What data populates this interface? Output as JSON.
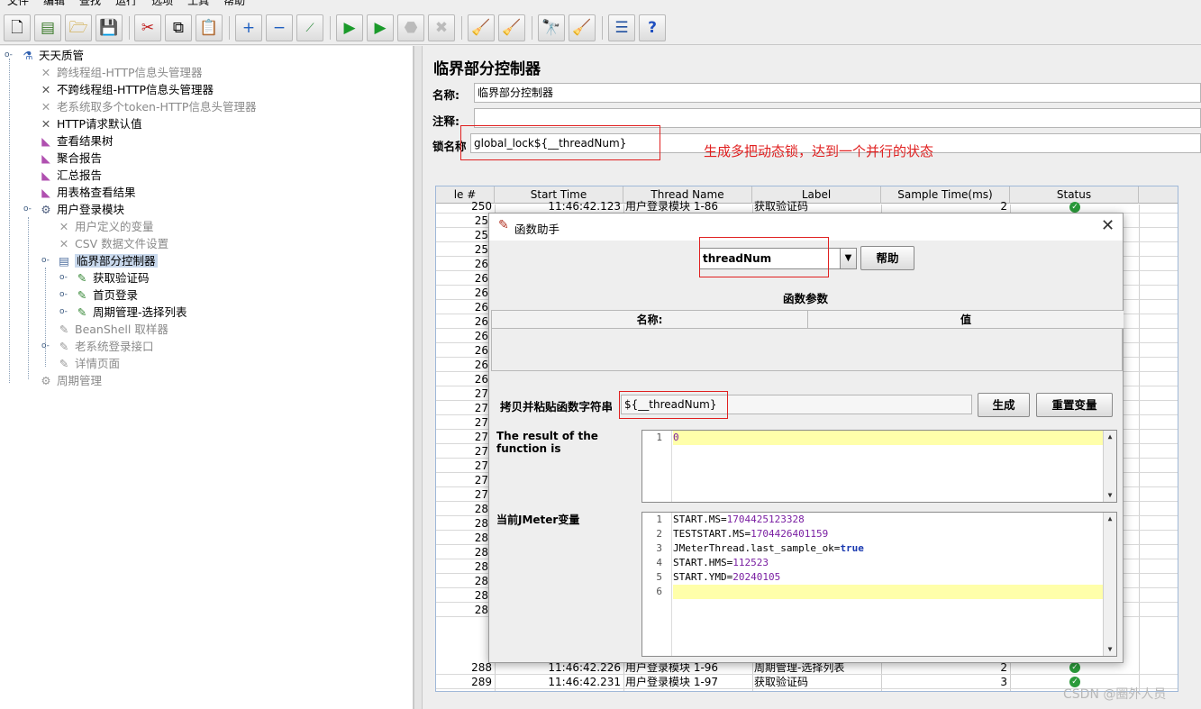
{
  "menubar": [
    "文件",
    "编辑",
    "查找",
    "运行",
    "选项",
    "工具",
    "帮助"
  ],
  "tree": {
    "nodes": [
      {
        "label": "天天质管",
        "icon": "test-plan-icon",
        "enabled": true,
        "selected": false
      },
      {
        "label": "跨线程组-HTTP信息头管理器",
        "icon": "wrench-icon",
        "enabled": false,
        "selected": false
      },
      {
        "label": "不跨线程组-HTTP信息头管理器",
        "icon": "wrench-icon",
        "enabled": true,
        "selected": false
      },
      {
        "label": "老系统取多个token-HTTP信息头管理器",
        "icon": "wrench-icon",
        "enabled": false,
        "selected": false
      },
      {
        "label": "HTTP请求默认值",
        "icon": "wrench-icon",
        "enabled": true,
        "selected": false
      },
      {
        "label": "查看结果树",
        "icon": "listener-icon",
        "enabled": true,
        "selected": false
      },
      {
        "label": "聚合报告",
        "icon": "listener-icon",
        "enabled": true,
        "selected": false
      },
      {
        "label": "汇总报告",
        "icon": "listener-icon",
        "enabled": true,
        "selected": false
      },
      {
        "label": "用表格查看结果",
        "icon": "listener-icon",
        "enabled": true,
        "selected": false
      },
      {
        "label": "用户登录模块",
        "icon": "gear-icon",
        "enabled": true,
        "selected": false
      },
      {
        "label": "用户定义的变量",
        "icon": "wrench-icon",
        "enabled": false,
        "selected": false
      },
      {
        "label": "CSV 数据文件设置",
        "icon": "wrench-icon",
        "enabled": false,
        "selected": false
      },
      {
        "label": "临界部分控制器",
        "icon": "controller-icon",
        "enabled": true,
        "selected": true
      },
      {
        "label": "获取验证码",
        "icon": "sampler-icon",
        "enabled": true,
        "selected": false
      },
      {
        "label": "首页登录",
        "icon": "sampler-icon",
        "enabled": true,
        "selected": false
      },
      {
        "label": "周期管理-选择列表",
        "icon": "sampler-icon",
        "enabled": true,
        "selected": false
      },
      {
        "label": "BeanShell 取样器",
        "icon": "sampler-icon",
        "enabled": false,
        "selected": false
      },
      {
        "label": "老系统登录接口",
        "icon": "sampler-icon",
        "enabled": false,
        "selected": false
      },
      {
        "label": "详情页面",
        "icon": "sampler-icon",
        "enabled": false,
        "selected": false
      },
      {
        "label": "周期管理",
        "icon": "gear-icon",
        "enabled": false,
        "selected": false
      }
    ]
  },
  "panel": {
    "title": "临界部分控制器",
    "name_label": "名称:",
    "name_value": "临界部分控制器",
    "comment_label": "注释:",
    "comment_value": "",
    "lock_label": "锁名称",
    "lock_value": "global_lock${__threadNum}",
    "annotation": "生成多把动态锁，达到一个并行的状态"
  },
  "results_table": {
    "columns": [
      "le #",
      "Start Time",
      "Thread Name",
      "Label",
      "Sample Time(ms)",
      "Status"
    ],
    "top_row": {
      "num": "250",
      "start": "11:46:42.123",
      "thread": "用户登录模块 1-86",
      "label": "获取验证码",
      "time": "2"
    },
    "row_numbers": [
      "25",
      "25",
      "25",
      "26",
      "26",
      "26",
      "26",
      "26",
      "26",
      "26",
      "26",
      "26",
      "27",
      "27",
      "27",
      "27",
      "27",
      "27",
      "27",
      "27",
      "28",
      "28",
      "28",
      "28",
      "28",
      "28",
      "28",
      "28"
    ],
    "bottom_rows": [
      {
        "num": "288",
        "start": "11:46:42.226",
        "thread": "用户登录模块 1-96",
        "label": "周期管理-选择列表",
        "time": "2"
      },
      {
        "num": "289",
        "start": "11:46:42.231",
        "thread": "用户登录模块 1-97",
        "label": "获取验证码",
        "time": "3"
      }
    ]
  },
  "dialog": {
    "title": "函数助手",
    "function_selected": "threadNum",
    "help_button": "帮助",
    "params_title": "函数参数",
    "params_columns": [
      "名称:",
      "值"
    ],
    "copy_label": "拷贝并粘贴函数字符串",
    "copy_value": "${__threadNum}",
    "generate_button": "生成",
    "reset_button": "重置变量",
    "result_label": "The result of the function is",
    "result_lines": [
      {
        "n": "1",
        "text": "0"
      }
    ],
    "jmeter_label": "当前JMeter变量",
    "jmeter_lines": [
      {
        "n": "1",
        "key": "START.MS=",
        "val": "1704425123328"
      },
      {
        "n": "2",
        "key": "TESTSTART.MS=",
        "val": "1704426401159"
      },
      {
        "n": "3",
        "key": "JMeterThread.last_sample_ok=",
        "val": "true"
      },
      {
        "n": "4",
        "key": "START.HMS=",
        "val": "112523"
      },
      {
        "n": "5",
        "key": "START.YMD=",
        "val": "20240105"
      },
      {
        "n": "6",
        "key": "",
        "val": ""
      }
    ]
  },
  "watermark": "CSDN @圈外人员"
}
